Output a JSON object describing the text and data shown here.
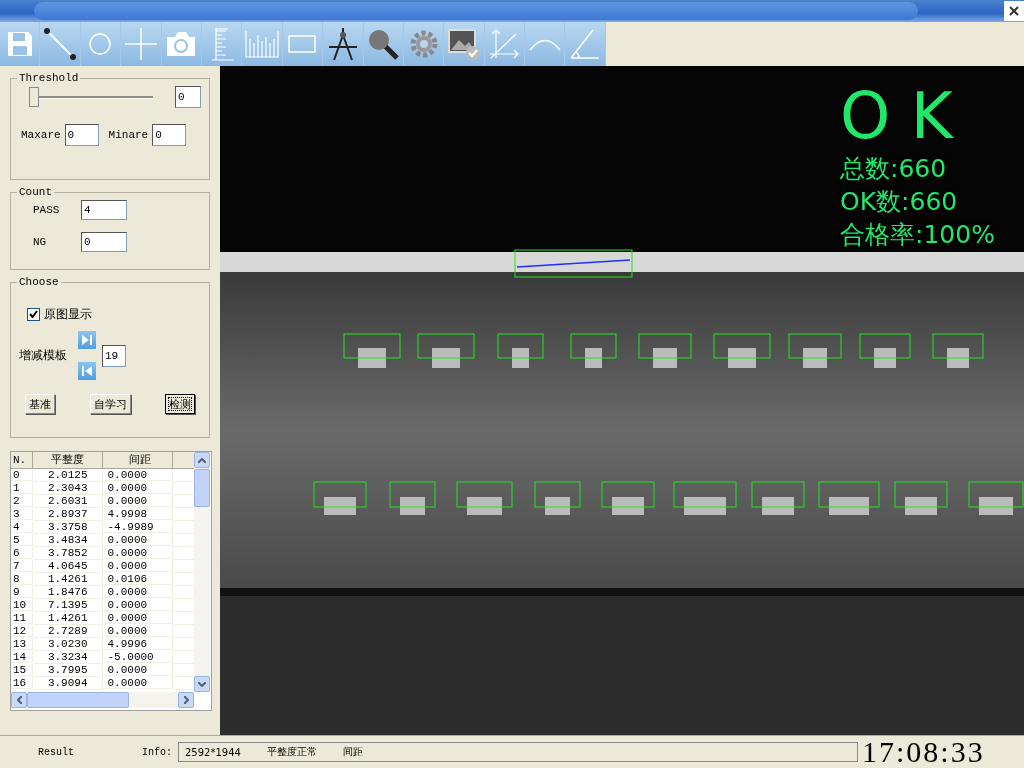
{
  "threshold": {
    "title": "Threshold",
    "slider": {
      "level": 0
    },
    "value": "0",
    "fields": [
      {
        "label": "Maxare",
        "value": "0"
      },
      {
        "label": "Minare",
        "value": "0"
      }
    ]
  },
  "count": {
    "title": "Count",
    "fields": [
      {
        "label": "PASS",
        "value": "4"
      },
      {
        "label": "NG",
        "value": "0"
      }
    ]
  },
  "choose": {
    "title": "Choose",
    "checkbox": {
      "label": "原图显示",
      "checked": true
    },
    "template": {
      "label": "增减模板",
      "value": "19"
    },
    "buttons": [
      {
        "label": "基准",
        "default": false
      },
      {
        "label": "自学习",
        "default": false
      },
      {
        "label": "检测",
        "default": true
      }
    ]
  },
  "table": {
    "columns": [
      "N.",
      "平整度",
      "间距"
    ],
    "rows": [
      [
        "0",
        "2.0125",
        "0.0000"
      ],
      [
        "1",
        "2.3043",
        "0.0000"
      ],
      [
        "2",
        "2.6031",
        "0.0000"
      ],
      [
        "3",
        "2.8937",
        "4.9998"
      ],
      [
        "4",
        "3.3758",
        "-4.9989"
      ],
      [
        "5",
        "3.4834",
        "0.0000"
      ],
      [
        "6",
        "3.7852",
        "0.0000"
      ],
      [
        "7",
        "4.0645",
        "0.0000"
      ],
      [
        "8",
        "1.4261",
        "0.0106"
      ],
      [
        "9",
        "1.8476",
        "0.0000"
      ],
      [
        "10",
        "7.1395",
        "0.0000"
      ],
      [
        "11",
        "1.4261",
        "0.0000"
      ],
      [
        "12",
        "2.7289",
        "0.0000"
      ],
      [
        "13",
        "3.0230",
        "4.9996"
      ],
      [
        "14",
        "3.3234",
        "-5.0000"
      ],
      [
        "15",
        "3.7995",
        "0.0000"
      ],
      [
        "16",
        "3.9094",
        "0.0000"
      ]
    ]
  },
  "overlay": {
    "verdict": "O K",
    "lines": [
      "总数:660",
      "OK数:660",
      "合格率:100%"
    ]
  },
  "status_bar": {
    "result_label": "Result",
    "info_label": "Info:",
    "info": [
      "2592*1944",
      "平整度正常",
      "间距"
    ],
    "clock": "17:08:33"
  }
}
